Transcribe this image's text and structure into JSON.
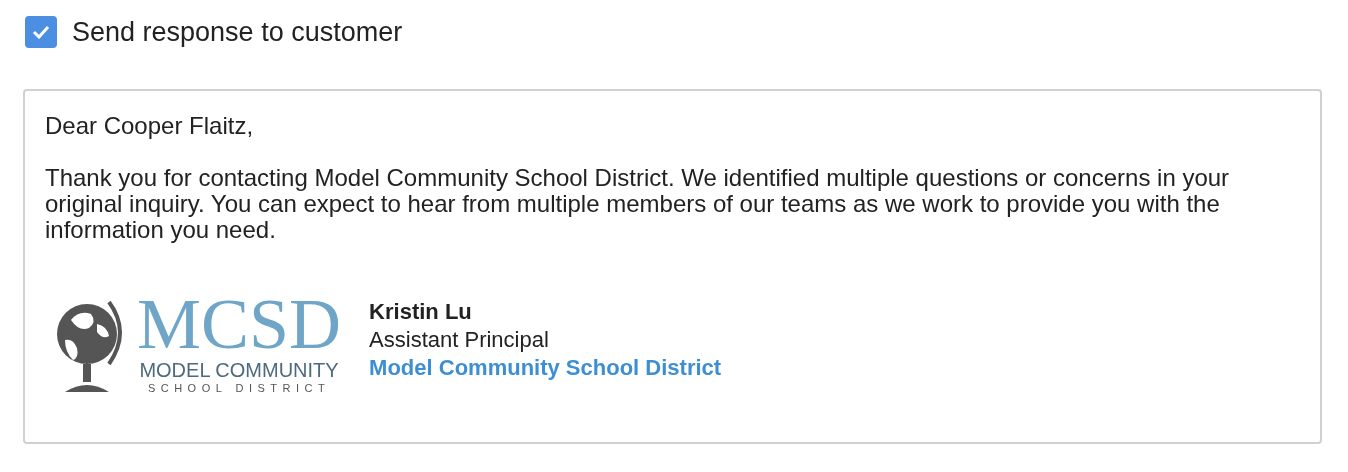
{
  "send_response": {
    "label": "Send response to customer",
    "checked": true
  },
  "message": {
    "greeting": "Dear Cooper Flaitz,",
    "body": "Thank you for contacting Model Community School District. We identified multiple questions or concerns in your original inquiry. You can expect to hear from multiple members of our teams as we work to provide you with the information you need.",
    "signature": {
      "logo": {
        "initials": "MCSD",
        "line_1": "MODEL COMMUNITY",
        "line_2": "SCHOOL DISTRICT"
      },
      "name": "Kristin Lu",
      "title": "Assistant Principal",
      "organization": "Model Community School District"
    }
  }
}
